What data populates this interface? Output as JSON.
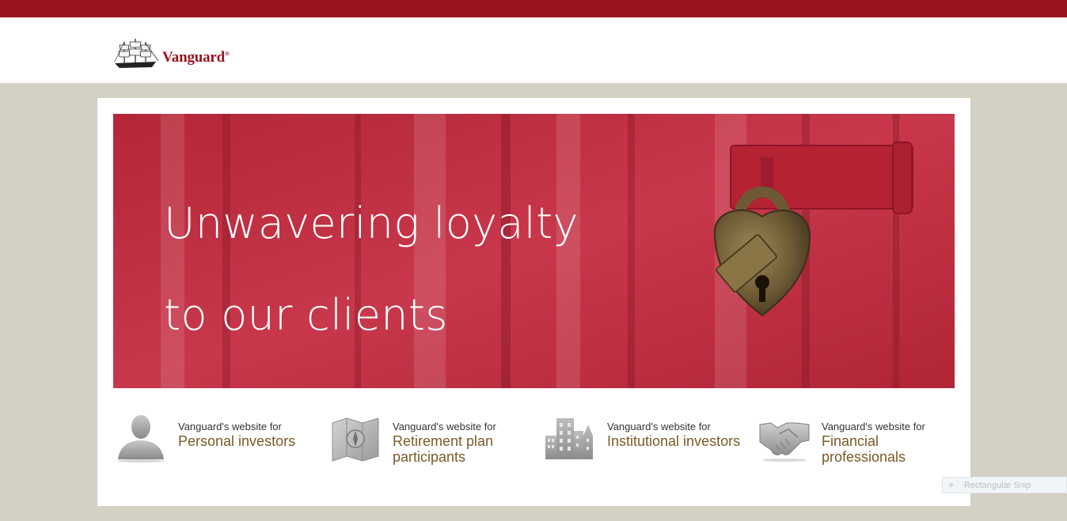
{
  "header": {
    "logo_text": "Vanguard",
    "logo_mark": "®",
    "brand_color": "#98141d"
  },
  "hero": {
    "title_line1": "Unwavering loyalty",
    "title_line2": "to our clients"
  },
  "links": [
    {
      "pre": "Vanguard's website for",
      "label": "Personal investors",
      "icon": "person-icon"
    },
    {
      "pre": "Vanguard's website for",
      "label": "Retirement plan participants",
      "icon": "map-compass-icon"
    },
    {
      "pre": "Vanguard's website for",
      "label": "Institutional investors",
      "icon": "buildings-icon"
    },
    {
      "pre": "Vanguard's website for",
      "label": "Financial professionals",
      "icon": "handshake-icon"
    }
  ],
  "overlay": {
    "snip_label": "Rectangular Snip"
  },
  "colors": {
    "page_bg": "#d3d0c4",
    "link_text": "#7b5a26",
    "hero_red": "#c02f43"
  }
}
